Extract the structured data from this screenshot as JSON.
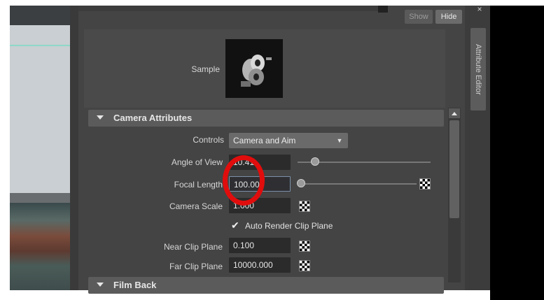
{
  "header": {
    "show_label": "Show",
    "hide_label": "Hide",
    "side_tab_label": "Attribute Editor"
  },
  "sample": {
    "label": "Sample",
    "image_icon": "render-sample-thumbnail-icon"
  },
  "camera_attributes": {
    "title": "Camera Attributes",
    "controls_label": "Controls",
    "controls_value": "Camera and Aim",
    "angle_of_view_label": "Angle of View",
    "angle_of_view_value": "10.41",
    "focal_length_label": "Focal Length",
    "focal_length_value": "100.000",
    "camera_scale_label": "Camera Scale",
    "camera_scale_value": "1.000",
    "auto_render_label": "Auto Render Clip Plane",
    "auto_render_checked": true,
    "near_clip_label": "Near Clip Plane",
    "near_clip_value": "0.100",
    "far_clip_label": "Far Clip Plane",
    "far_clip_value": "10000.000"
  },
  "film_back": {
    "title": "Film Back"
  },
  "colors": {
    "highlight_ring": "#e10d0d",
    "panel_bg": "#444444"
  }
}
